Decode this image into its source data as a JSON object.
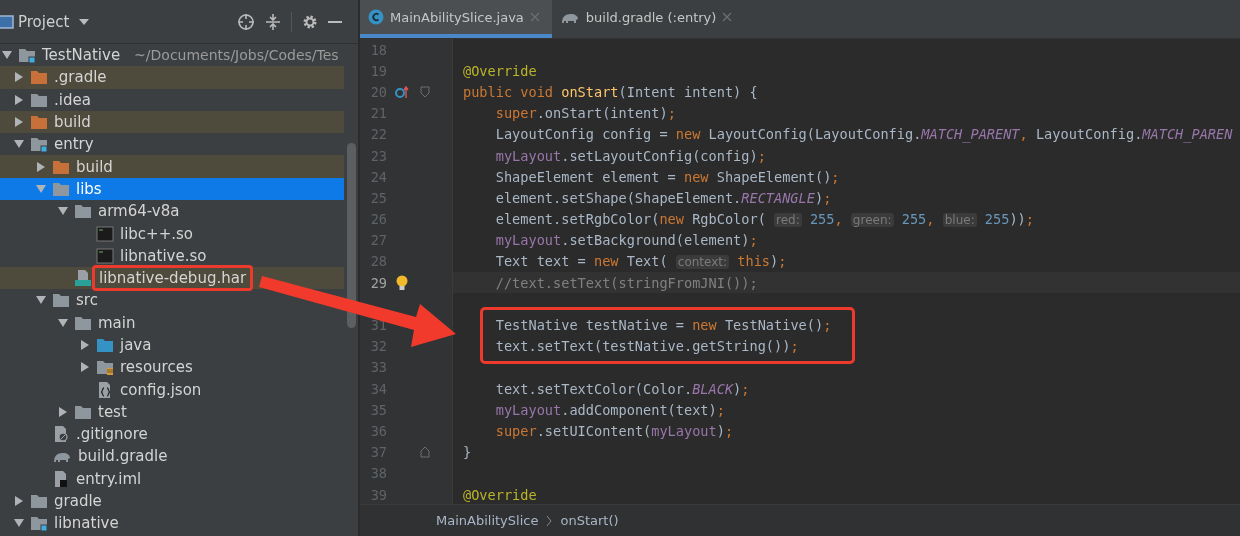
{
  "project_panel": {
    "title": "Project",
    "tree": [
      {
        "name": "TestNative",
        "path_hint": "~/Documents/Jobs/Codes/Tes",
        "kind": "module",
        "expanded": true,
        "selected": false,
        "ignored": false,
        "children": [
          {
            "name": ".gradle",
            "kind": "folder-excluded",
            "expanded": false,
            "selected": false,
            "ignored": true
          },
          {
            "name": ".idea",
            "kind": "folder",
            "expanded": false,
            "selected": false,
            "ignored": false
          },
          {
            "name": "build",
            "kind": "folder-excluded",
            "expanded": false,
            "selected": false,
            "ignored": true
          },
          {
            "name": "entry",
            "kind": "module",
            "expanded": true,
            "selected": false,
            "ignored": false,
            "children": [
              {
                "name": "build",
                "kind": "folder-excluded",
                "expanded": false,
                "selected": false,
                "ignored": true
              },
              {
                "name": "libs",
                "kind": "folder",
                "expanded": true,
                "selected": true,
                "ignored": false,
                "children": [
                  {
                    "name": "arm64-v8a",
                    "kind": "folder",
                    "expanded": true,
                    "selected": false,
                    "ignored": false,
                    "children": [
                      {
                        "name": "libc++.so",
                        "kind": "binary",
                        "selected": false,
                        "ignored": false
                      },
                      {
                        "name": "libnative.so",
                        "kind": "binary",
                        "selected": false,
                        "ignored": false
                      }
                    ]
                  },
                  {
                    "name": "libnative-debug.har",
                    "kind": "har",
                    "selected": false,
                    "ignored": true,
                    "annotated": true
                  }
                ]
              },
              {
                "name": "src",
                "kind": "folder",
                "expanded": true,
                "selected": false,
                "ignored": false,
                "children": [
                  {
                    "name": "main",
                    "kind": "folder",
                    "expanded": true,
                    "selected": false,
                    "ignored": false,
                    "children": [
                      {
                        "name": "java",
                        "kind": "folder-source",
                        "expanded": false,
                        "selected": false,
                        "ignored": false
                      },
                      {
                        "name": "resources",
                        "kind": "folder-resources",
                        "expanded": false,
                        "selected": false,
                        "ignored": false
                      },
                      {
                        "name": "config.json",
                        "kind": "json",
                        "selected": false,
                        "ignored": false
                      }
                    ]
                  },
                  {
                    "name": "test",
                    "kind": "folder",
                    "expanded": false,
                    "selected": false,
                    "ignored": false
                  }
                ]
              },
              {
                "name": ".gitignore",
                "kind": "ignore-file",
                "selected": false,
                "ignored": false
              },
              {
                "name": "build.gradle",
                "kind": "gradle",
                "selected": false,
                "ignored": false
              },
              {
                "name": "entry.iml",
                "kind": "iml",
                "selected": false,
                "ignored": false
              }
            ]
          },
          {
            "name": "gradle",
            "kind": "folder",
            "expanded": false,
            "selected": false,
            "ignored": false
          },
          {
            "name": "libnative",
            "kind": "module",
            "expanded": true,
            "selected": false,
            "ignored": false
          }
        ]
      }
    ]
  },
  "editor": {
    "tabs": [
      {
        "label": "MainAbilitySlice.java",
        "kind": "java",
        "selected": true
      },
      {
        "label": "build.gradle (:entry)",
        "kind": "gradle",
        "selected": false
      }
    ],
    "lines": [
      {
        "number": "18"
      },
      {
        "number": "19",
        "tokens": [
          {
            "kind": "annotation",
            "text": "@Override"
          }
        ]
      },
      {
        "number": "20",
        "override": true,
        "fold_start": true,
        "tokens": [
          {
            "kind": "keyword",
            "text": "public void "
          },
          {
            "kind": "declaration",
            "text": "onStart"
          },
          {
            "kind": "plain",
            "text": "(Intent intent) {"
          }
        ]
      },
      {
        "number": "21",
        "tokens": [
          {
            "kind": "keyword",
            "text": "    super"
          },
          {
            "kind": "plain",
            "text": ".onStart(intent)"
          },
          {
            "kind": "keyword",
            "text": ";"
          }
        ]
      },
      {
        "number": "22",
        "tokens": [
          {
            "kind": "plain",
            "text": "    LayoutConfig config = "
          },
          {
            "kind": "keyword",
            "text": "new "
          },
          {
            "kind": "plain",
            "text": "LayoutConfig(LayoutConfig."
          },
          {
            "kind": "constant",
            "text": "MATCH_PARENT"
          },
          {
            "kind": "keyword",
            "text": ", "
          },
          {
            "kind": "plain",
            "text": "LayoutConfig."
          },
          {
            "kind": "constant",
            "text": "MATCH_PAREN"
          }
        ]
      },
      {
        "number": "23",
        "tokens": [
          {
            "kind": "field",
            "text": "    myLayout"
          },
          {
            "kind": "plain",
            "text": ".setLayoutConfig(config)"
          },
          {
            "kind": "keyword",
            "text": ";"
          }
        ]
      },
      {
        "number": "24",
        "tokens": [
          {
            "kind": "plain",
            "text": "    ShapeElement element = "
          },
          {
            "kind": "keyword",
            "text": "new "
          },
          {
            "kind": "plain",
            "text": "ShapeElement()"
          },
          {
            "kind": "keyword",
            "text": ";"
          }
        ]
      },
      {
        "number": "25",
        "tokens": [
          {
            "kind": "plain",
            "text": "    element.setShape(ShapeElement."
          },
          {
            "kind": "constant",
            "text": "RECTANGLE"
          },
          {
            "kind": "plain",
            "text": ")"
          },
          {
            "kind": "keyword",
            "text": ";"
          }
        ]
      },
      {
        "number": "26",
        "tokens": [
          {
            "kind": "plain",
            "text": "    element.setRgbColor("
          },
          {
            "kind": "keyword",
            "text": "new "
          },
          {
            "kind": "plain",
            "text": "RgbColor( "
          },
          {
            "kind": "hint",
            "text": "red:"
          },
          {
            "kind": "number",
            "text": " 255"
          },
          {
            "kind": "keyword",
            "text": ", "
          },
          {
            "kind": "hint",
            "text": "green:"
          },
          {
            "kind": "number",
            "text": " 255"
          },
          {
            "kind": "keyword",
            "text": ", "
          },
          {
            "kind": "hint",
            "text": "blue:"
          },
          {
            "kind": "number",
            "text": " 255"
          },
          {
            "kind": "plain",
            "text": "))"
          },
          {
            "kind": "keyword",
            "text": ";"
          }
        ]
      },
      {
        "number": "27",
        "tokens": [
          {
            "kind": "field",
            "text": "    myLayout"
          },
          {
            "kind": "plain",
            "text": ".setBackground(element)"
          },
          {
            "kind": "keyword",
            "text": ";"
          }
        ]
      },
      {
        "number": "28",
        "tokens": [
          {
            "kind": "plain",
            "text": "    Text text = "
          },
          {
            "kind": "keyword",
            "text": "new "
          },
          {
            "kind": "plain",
            "text": "Text( "
          },
          {
            "kind": "hint",
            "text": "context:"
          },
          {
            "kind": "keyword",
            "text": " this"
          },
          {
            "kind": "plain",
            "text": ")"
          },
          {
            "kind": "keyword",
            "text": ";"
          }
        ]
      },
      {
        "number": "29",
        "bulb": true,
        "current": true,
        "tokens": [
          {
            "kind": "comment",
            "text": "    //text.setText(stringFromJNI());"
          }
        ]
      },
      {
        "number": "31",
        "boxed": true,
        "tokens": [
          {
            "kind": "plain",
            "text": "    TestNative testNative = "
          },
          {
            "kind": "keyword",
            "text": "new "
          },
          {
            "kind": "plain",
            "text": "TestNative()"
          },
          {
            "kind": "keyword",
            "text": ";"
          }
        ]
      },
      {
        "number": "32",
        "boxed": true,
        "tokens": [
          {
            "kind": "plain",
            "text": "    text.setText(testNative.getString())"
          },
          {
            "kind": "keyword",
            "text": ";"
          }
        ]
      },
      {
        "number": "33"
      },
      {
        "number": "34",
        "tokens": [
          {
            "kind": "plain",
            "text": "    text.setTextColor(Color."
          },
          {
            "kind": "constant",
            "text": "BLACK"
          },
          {
            "kind": "plain",
            "text": ")"
          },
          {
            "kind": "keyword",
            "text": ";"
          }
        ]
      },
      {
        "number": "35",
        "tokens": [
          {
            "kind": "field",
            "text": "    myLayout"
          },
          {
            "kind": "plain",
            "text": ".addComponent(text)"
          },
          {
            "kind": "keyword",
            "text": ";"
          }
        ]
      },
      {
        "number": "36",
        "tokens": [
          {
            "kind": "keyword",
            "text": "    super"
          },
          {
            "kind": "plain",
            "text": ".setUIContent("
          },
          {
            "kind": "field",
            "text": "myLayout"
          },
          {
            "kind": "plain",
            "text": ")"
          },
          {
            "kind": "keyword",
            "text": ";"
          }
        ]
      },
      {
        "number": "37",
        "fold_end": true,
        "tokens": [
          {
            "kind": "plain",
            "text": "}"
          }
        ]
      },
      {
        "number": "38"
      },
      {
        "number": "39",
        "tokens": [
          {
            "kind": "annotation",
            "text": "@Override"
          }
        ]
      }
    ],
    "breadcrumb": [
      "MainAbilitySlice",
      "onStart()"
    ]
  }
}
